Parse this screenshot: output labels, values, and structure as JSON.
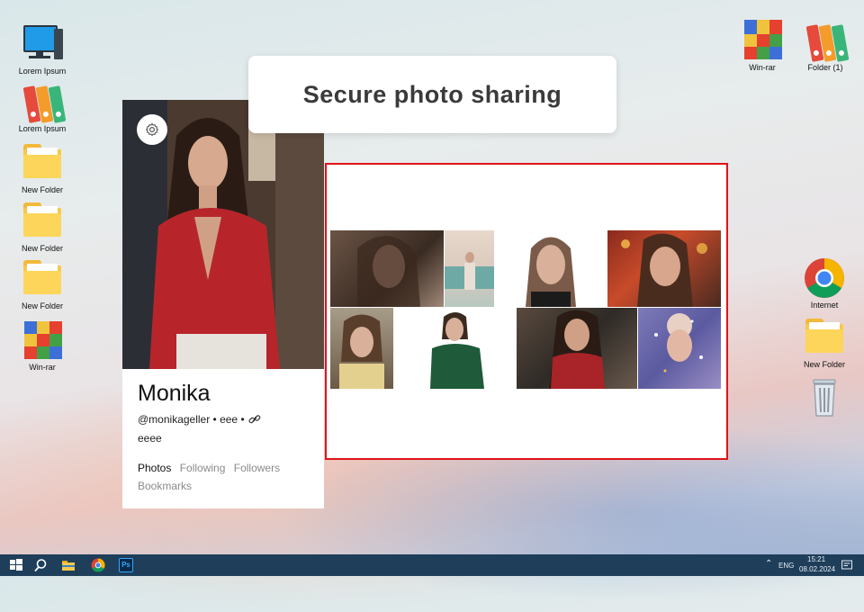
{
  "desktop": {
    "left_icons": [
      {
        "label": "Lorem Ipsum",
        "icon": "computer-icon"
      },
      {
        "label": "Lorem Ipsum",
        "icon": "binders-icon"
      },
      {
        "label": "New Folder",
        "icon": "folder-icon"
      },
      {
        "label": "New Folder",
        "icon": "folder-icon"
      },
      {
        "label": "New Folder",
        "icon": "folder-icon"
      },
      {
        "label": "Win-rar",
        "icon": "winrar-icon"
      }
    ],
    "top_right_icons": [
      {
        "label": "Win-rar",
        "icon": "winrar-icon"
      },
      {
        "label": "Folder (1)",
        "icon": "binders-icon"
      }
    ],
    "right_icons": [
      {
        "label": "Internet",
        "icon": "chrome-icon"
      },
      {
        "label": "New Folder",
        "icon": "folder-icon"
      },
      {
        "label": "",
        "icon": "recycle-bin-icon"
      }
    ]
  },
  "banner": {
    "title": "Secure photo sharing"
  },
  "profile": {
    "name": "Monika",
    "handle": "@monikageller • eee •",
    "bio": "eeee",
    "tabs": [
      "Photos",
      "Following",
      "Followers",
      "Bookmarks"
    ],
    "active_tab": "Photos"
  },
  "gallery": {
    "photo_count": 8
  },
  "taskbar": {
    "apps": [
      "start-icon",
      "search-icon",
      "file-explorer-icon",
      "chrome-icon",
      "photoshop-icon"
    ],
    "photoshop_label": "Ps",
    "language": "ENG",
    "time": "15:21",
    "date": "08.02.2024"
  },
  "colors": {
    "accent_border": "#e0131a",
    "taskbar": "#1e3e5a"
  }
}
